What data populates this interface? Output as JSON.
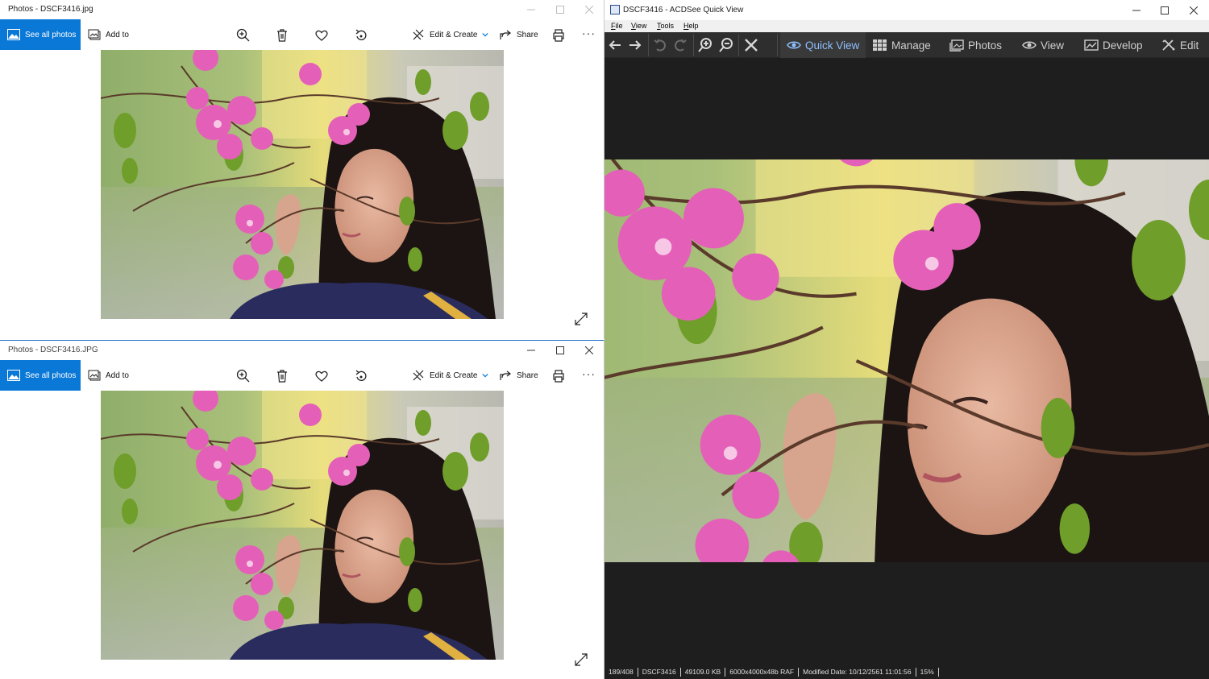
{
  "photos_top": {
    "title": "Photos - DSCF3416.jpg",
    "see_all": "See all photos",
    "add_to": "Add to",
    "edit_create": "Edit & Create",
    "share": "Share",
    "more": "···"
  },
  "photos_bottom": {
    "title": "Photos - DSCF3416.JPG",
    "see_all": "See all photos",
    "add_to": "Add to",
    "edit_create": "Edit & Create",
    "share": "Share",
    "more": "···"
  },
  "acdsee": {
    "title": "DSCF3416 - ACDSee Quick View",
    "menu": [
      "File",
      "View",
      "Tools",
      "Help"
    ],
    "modes": [
      "Quick View",
      "Manage",
      "Photos",
      "View",
      "Develop",
      "Edit"
    ],
    "status": [
      "189/408",
      "DSCF3416",
      "49109.0 KB",
      "6000x4000x48b RAF",
      "Modified Date: 10/12/2561 11:01:56",
      "15%"
    ]
  },
  "colors": {
    "accent": "#0a78d7",
    "acdsee_active": "#8fbfff",
    "acdsee_bg": "#1e1e1e"
  }
}
